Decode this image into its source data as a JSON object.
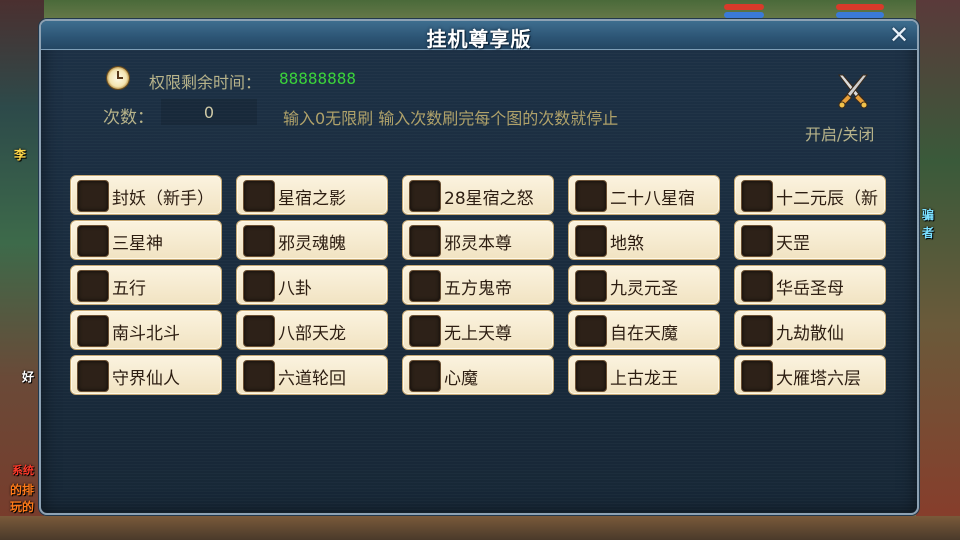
{
  "dialog": {
    "title": "挂机尊享版",
    "close_label": "✕",
    "time_label": "权限剩余时间：",
    "time_value": "88888888",
    "count_label": "次数：",
    "count_value": "0",
    "count_hint": "输入0无限刷 输入次数刷完每个图的次数就停止",
    "toggle_label": "开启/关闭",
    "toggle_icon": "crossed-swords-icon",
    "clock_icon": "clock-icon"
  },
  "grid": {
    "rows": [
      [
        "封妖（新手）",
        "星宿之影",
        "28星宿之怒",
        "二十八星宿",
        "十二元辰（新"
      ],
      [
        "三星神",
        "邪灵魂魄",
        "邪灵本尊",
        "地煞",
        "天罡"
      ],
      [
        "五行",
        "八卦",
        "五方鬼帝",
        "九灵元圣",
        "华岳圣母"
      ],
      [
        "南斗北斗",
        "八部天龙",
        "无上天尊",
        "自在天魔",
        "九劫散仙"
      ],
      [
        "守界仙人",
        "六道轮回",
        "心魔",
        "上古龙王",
        "大雁塔六层"
      ]
    ]
  },
  "side": {
    "left_1": "李",
    "left_2": "好",
    "left_3": "系统",
    "left_4": "的排",
    "left_5": "玩的",
    "right_1": "骗",
    "right_2": "者"
  },
  "colors": {
    "time_value": "#3bd13b",
    "label": "#b7b38a",
    "cell_bg": "#f1e3c2",
    "checkbox": "#2d2118"
  }
}
